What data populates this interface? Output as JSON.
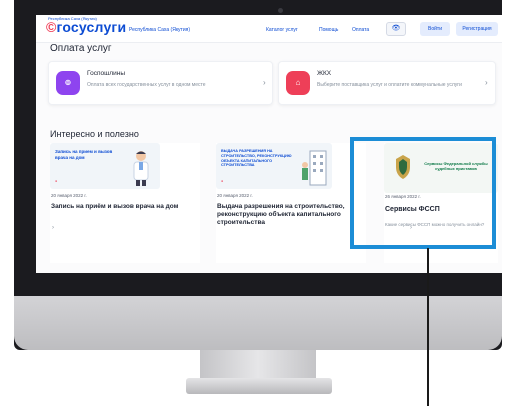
{
  "header": {
    "logo_tag": "Республика Саха (Якутия)",
    "logo_main": "госуслуги",
    "region": "Республика Саха (Якутия)",
    "nav": [
      "Каталог услуг",
      "Помощь",
      "Оплата"
    ],
    "accessibility_icon": "eye-icon",
    "login_label": "Войти",
    "register_label": "Регистрация"
  },
  "payments": {
    "title": "Оплата услуг",
    "cards": [
      {
        "title": "Госпошлины",
        "desc": "Оплата всех государственных услуг в одном месте",
        "icon": "receipt-icon",
        "icon_color": "#8e44ef"
      },
      {
        "title": "ЖКХ",
        "desc": "Выберите поставщика услуг и оплатите коммунальные услуги",
        "icon": "house-icon",
        "icon_color": "#ee3f58"
      }
    ]
  },
  "interesting": {
    "title": "Интересно и полезно",
    "cards": [
      {
        "banner": "Запись на прием и вызов врача на дом",
        "date": "20 января 2022 г.",
        "title": "Запись на приём и вызов врача на дом"
      },
      {
        "banner": "ВЫДАЧА РАЗРЕШЕНИЯ НА СТРОИТЕЛЬСТВО, РЕКОНСТРУКЦИЮ ОБЪЕКТА КАПИТАЛЬНОГО СТРОИТЕЛЬСТВА",
        "date": "20 января 2022 г.",
        "title": "Выдача разрешения на строительство, реконструкцию объекта капитального строительства"
      },
      {
        "banner": "Сервисы Федеральной службы судебных приставов",
        "date": "26 января 2022 г.",
        "title": "Сервисы ФССП",
        "desc": "Какие сервисы ФССП можно получить онлайн?"
      }
    ]
  },
  "colors": {
    "brand_blue": "#0d4cd3",
    "brand_red": "#ee3f58",
    "highlight": "#1c8dd6"
  }
}
